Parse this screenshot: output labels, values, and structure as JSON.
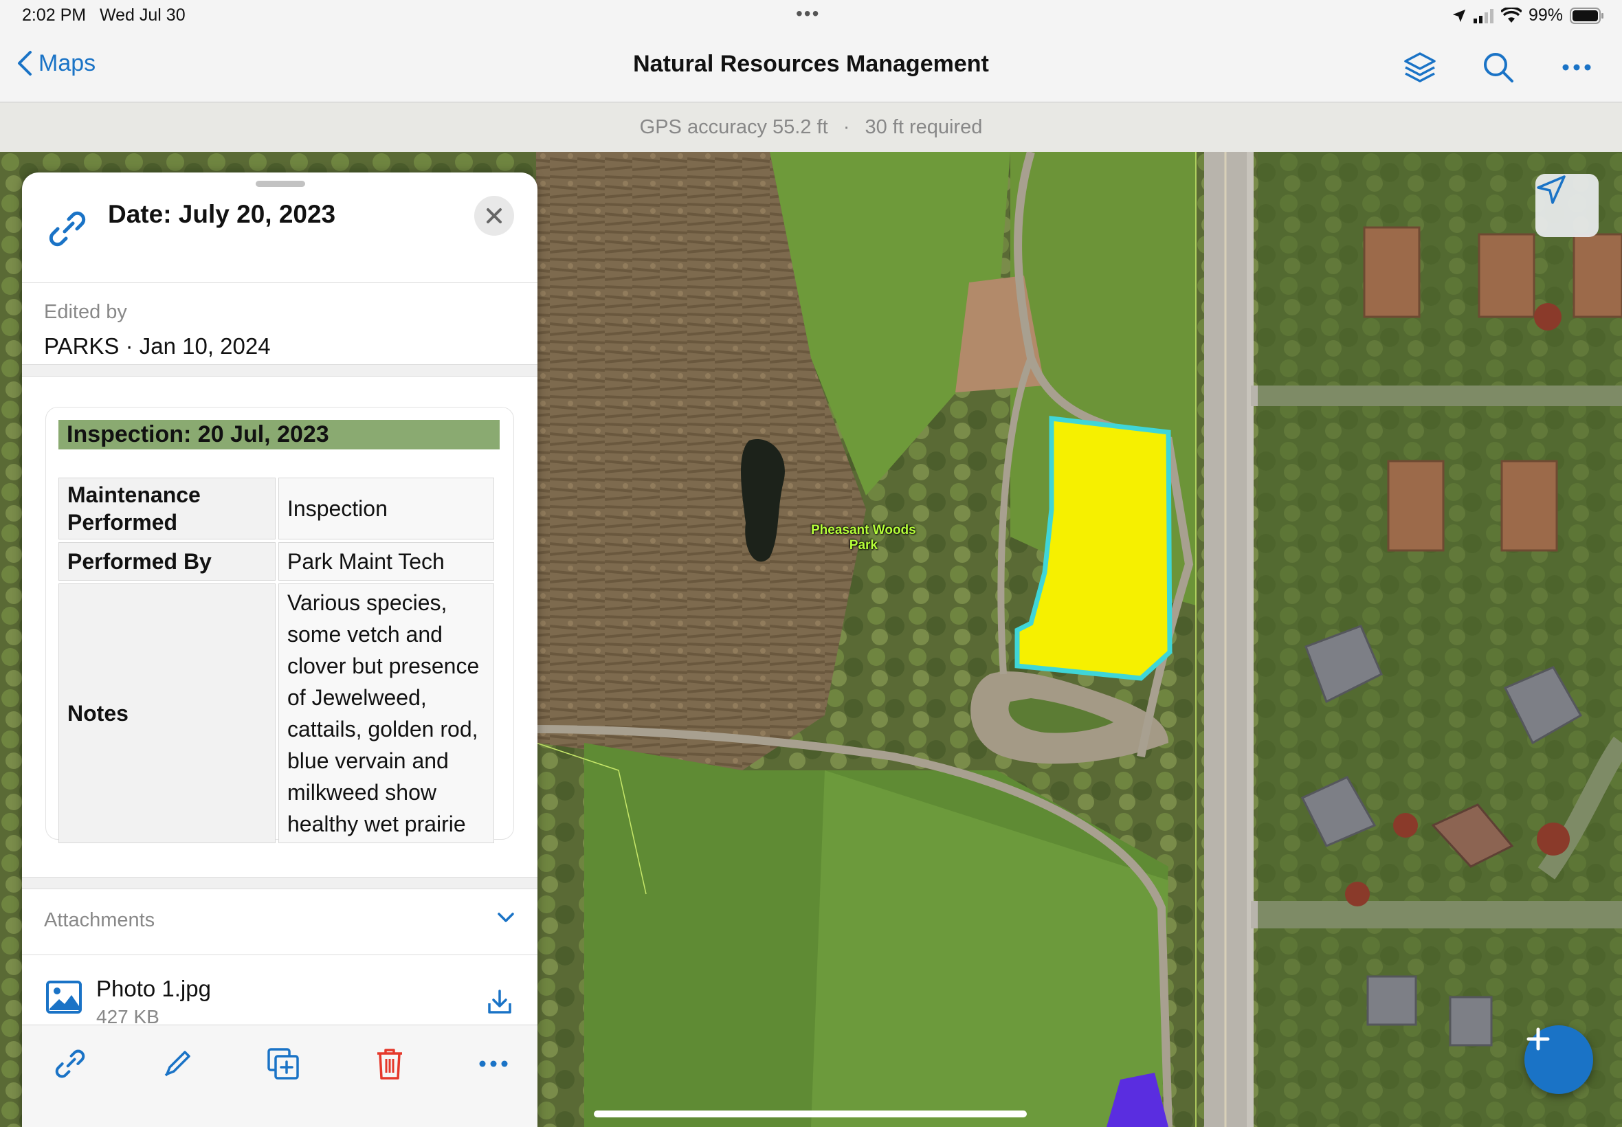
{
  "status_bar": {
    "time": "2:02 PM",
    "date": "Wed Jul 30",
    "battery": "99%"
  },
  "nav": {
    "back_label": "Maps",
    "title": "Natural Resources Management"
  },
  "gps": {
    "accuracy": "GPS accuracy 55.2 ft",
    "separator": "·",
    "required": "30 ft required"
  },
  "map": {
    "park_label_line1": "Pheasant Woods",
    "park_label_line2": "Park",
    "highlight_color": "#f6f000",
    "outline_color": "#3fd6d8"
  },
  "panel": {
    "title": "Date: July 20, 2023",
    "edited_label": "Edited by",
    "edited_value": "PARKS · Jan 10, 2024",
    "inspection_title": "Inspection: 20 Jul, 2023",
    "table": [
      {
        "key": "Maintenance Performed",
        "value": "Inspection"
      },
      {
        "key": "Performed By",
        "value": "Park Maint Tech"
      },
      {
        "key": "Notes",
        "value": "Various species, some vetch and clover but presence of Jewelweed, cattails, golden rod, blue vervain and milkweed show healthy wet prairie"
      }
    ],
    "attachments_label": "Attachments",
    "attachment": {
      "name": "Photo 1.jpg",
      "size": "427 KB"
    }
  },
  "colors": {
    "accent": "#1a73c6",
    "delete": "#e5382b"
  }
}
